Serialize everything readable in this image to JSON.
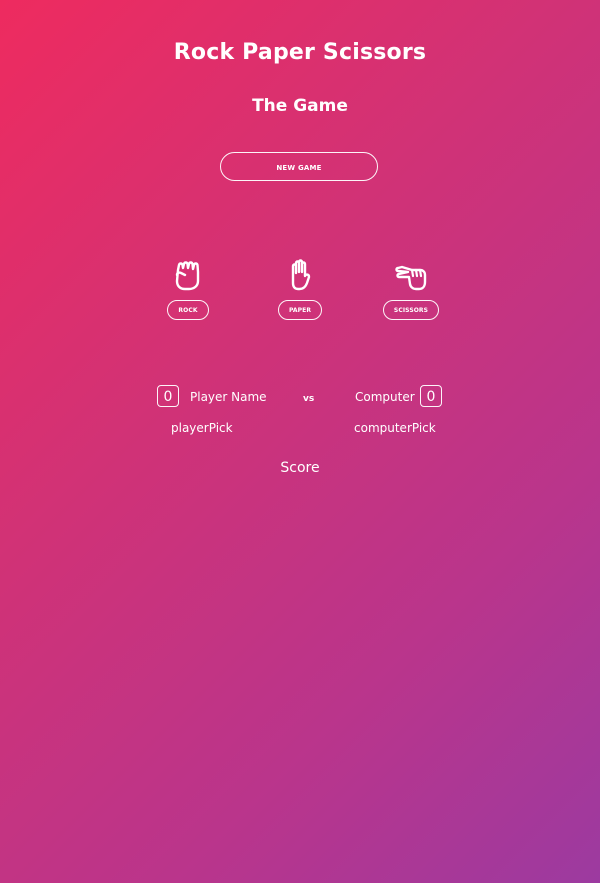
{
  "header": {
    "title": "Rock Paper Scissors",
    "subtitle": "The Game"
  },
  "controls": {
    "new_game_label": "NEW GAME"
  },
  "choices": [
    {
      "id": "rock",
      "label": "ROCK",
      "icon": "rock-hand-icon"
    },
    {
      "id": "paper",
      "label": "PAPER",
      "icon": "paper-hand-icon"
    },
    {
      "id": "scissors",
      "label": "SCISSORS",
      "icon": "scissors-hand-icon"
    }
  ],
  "scoreboard": {
    "player_score": "0",
    "player_name": "Player Name",
    "versus": "vs",
    "computer_name": "Computer",
    "computer_score": "0",
    "player_pick": "playerPick",
    "computer_pick": "computerPick",
    "score_label": "Score"
  }
}
